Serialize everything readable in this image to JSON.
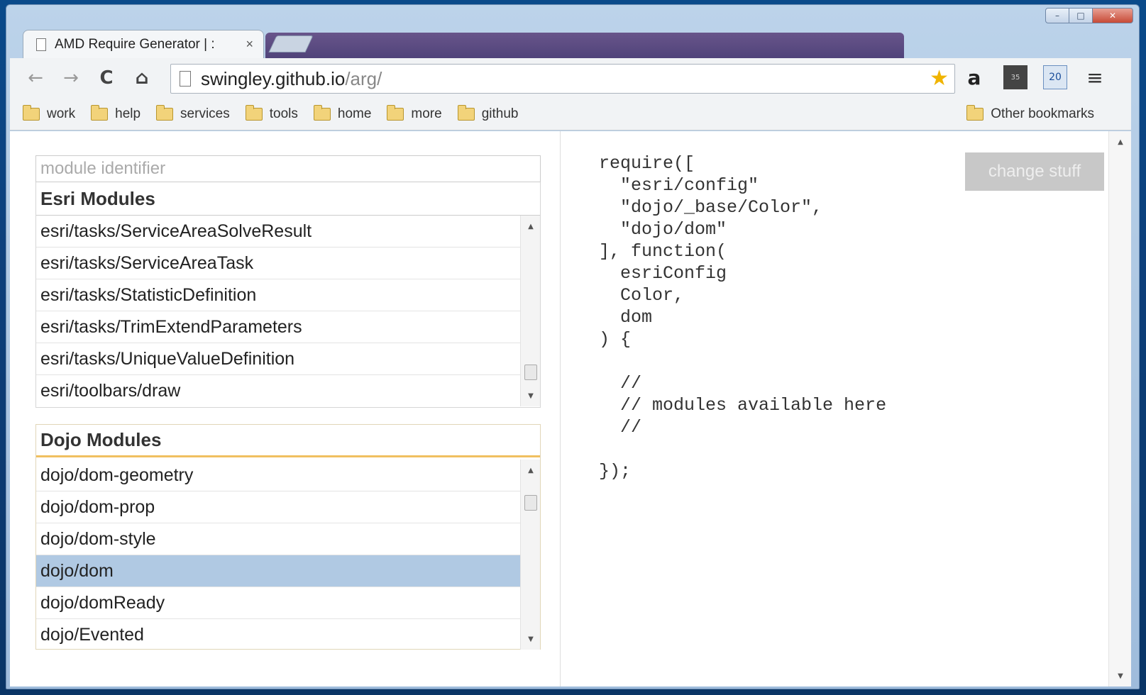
{
  "window": {
    "controls": {
      "minimize": "–",
      "maximize": "□",
      "close": "✕"
    }
  },
  "tab": {
    "title": "AMD Require Generator | :",
    "close": "×"
  },
  "toolbar": {
    "back": "←",
    "forward": "→",
    "reload": "C",
    "home": "⌂",
    "url_host": "swingley.github.io",
    "url_path": "/arg/",
    "star": "★",
    "amazon": "a",
    "ext_dark": "35",
    "ext_blue": "20",
    "menu": "≡"
  },
  "bookmarks": {
    "items": [
      "work",
      "help",
      "services",
      "tools",
      "home",
      "more",
      "github"
    ],
    "other": "Other bookmarks"
  },
  "left": {
    "search_placeholder": "module identifier",
    "esri": {
      "title": "Esri Modules",
      "items": [
        "esri/tasks/ServiceAreaSolveResult",
        "esri/tasks/ServiceAreaTask",
        "esri/tasks/StatisticDefinition",
        "esri/tasks/TrimExtendParameters",
        "esri/tasks/UniqueValueDefinition",
        "esri/toolbars/draw"
      ]
    },
    "dojo": {
      "title": "Dojo Modules",
      "items": [
        "dojo/dom-geometry",
        "dojo/dom-prop",
        "dojo/dom-style",
        "dojo/dom",
        "dojo/domReady",
        "dojo/Evented"
      ],
      "selected": "dojo/dom"
    }
  },
  "code": {
    "text": "require([\n  \"esri/config\"\n  \"dojo/_base/Color\",\n  \"dojo/dom\"\n], function(\n  esriConfig\n  Color,\n  dom\n) {\n\n  //\n  // modules available here\n  //\n\n});"
  },
  "change_button": "change stuff",
  "scroll": {
    "up": "▲",
    "down": "▼"
  }
}
